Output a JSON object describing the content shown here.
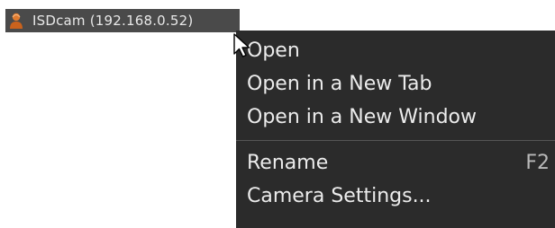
{
  "tree": {
    "item_label": "ISDcam (192.168.0.52)",
    "icon": "camera-person-icon"
  },
  "context_menu": {
    "items": [
      {
        "label": "Open",
        "shortcut": ""
      },
      {
        "label": "Open in a New Tab",
        "shortcut": ""
      },
      {
        "label": "Open in a New Window",
        "shortcut": ""
      },
      {
        "label": "Rename",
        "shortcut": "F2"
      },
      {
        "label": "Camera Settings...",
        "shortcut": ""
      }
    ]
  },
  "colors": {
    "menu_background": "#2b2b2b",
    "tree_item_background": "#4a4a4a",
    "menu_text": "#ececec",
    "icon_orange": "#e07a2e"
  }
}
